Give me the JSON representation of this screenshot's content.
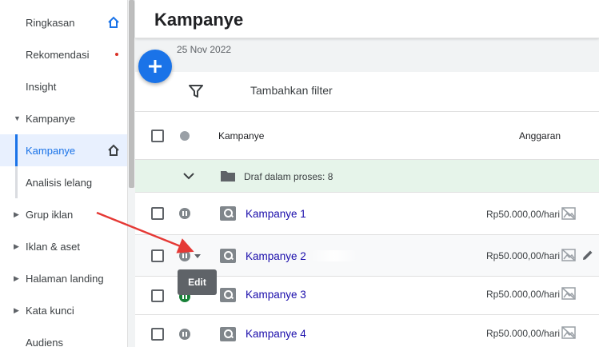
{
  "sidebar": {
    "items": [
      {
        "label": "Ringkasan",
        "icon": "home-icon"
      },
      {
        "label": "Rekomendasi",
        "badge": "red-dot"
      },
      {
        "label": "Insight"
      },
      {
        "label": "Kampanye",
        "expandable": "expanded"
      },
      {
        "label": "Kampanye",
        "active": true,
        "icon": "home-icon"
      },
      {
        "label": "Analisis lelang"
      },
      {
        "label": "Grup iklan",
        "expandable": "collapsed"
      },
      {
        "label": "Iklan & aset",
        "expandable": "collapsed"
      },
      {
        "label": "Halaman landing",
        "expandable": "collapsed"
      },
      {
        "label": "Kata kunci",
        "expandable": "collapsed"
      },
      {
        "label": "Audiens"
      }
    ]
  },
  "header": {
    "title": "Kampanye"
  },
  "date_range": {
    "text": "25 Nov 2022"
  },
  "filter": {
    "label": "Tambahkan filter"
  },
  "table": {
    "columns": [
      "Kampanye",
      "Anggaran"
    ],
    "draft_label": "Draf dalam proses: 8",
    "rows": [
      {
        "name": "Kampanye 1",
        "budget": "Rp50.000,00/hari",
        "status": "paused"
      },
      {
        "name": "Kampanye 2",
        "budget": "Rp50.000,00/hari",
        "status": "paused"
      },
      {
        "name": "Kampanye 3",
        "budget": "Rp50.000,00/hari",
        "status": "enabled"
      },
      {
        "name": "Kampanye 4",
        "budget": "Rp50.000,00/hari",
        "status": "paused"
      }
    ]
  },
  "tooltip": {
    "text": "Edit"
  },
  "colors": {
    "accent": "#1a73e8",
    "link": "#1a0dab",
    "draft_row_bg": "#e6f4ea",
    "alert_dot": "#d93025",
    "annotation_arrow": "#e53935"
  }
}
